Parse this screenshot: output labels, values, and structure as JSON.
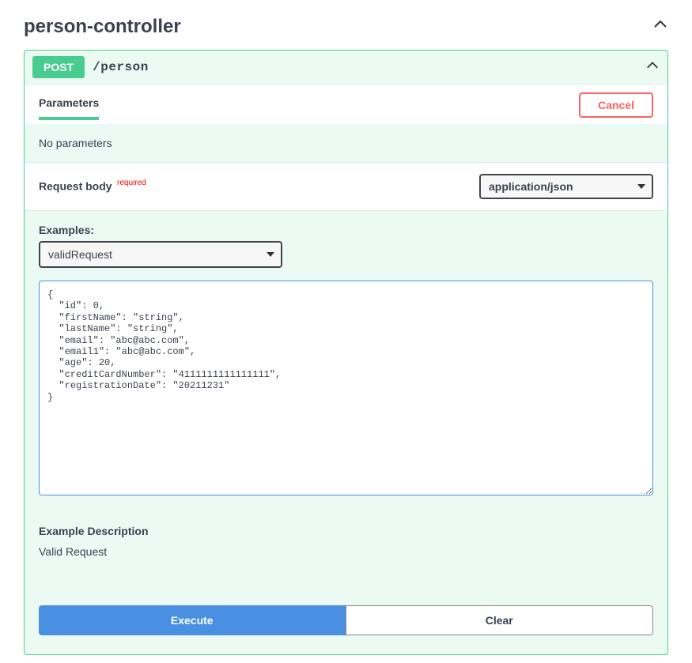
{
  "controller": {
    "title": "person-controller"
  },
  "operation": {
    "method": "POST",
    "path": "/person"
  },
  "parameters": {
    "tab_label": "Parameters",
    "cancel_label": "Cancel",
    "no_params_text": "No parameters"
  },
  "request_body": {
    "label": "Request body",
    "required_label": "required",
    "content_type": "application/json"
  },
  "examples": {
    "label": "Examples:",
    "selected": "validRequest"
  },
  "body_text": "{\n  \"id\": 0,\n  \"firstName\": \"string\",\n  \"lastName\": \"string\",\n  \"email\": \"abc@abc.com\",\n  \"email1\": \"abc@abc.com\",\n  \"age\": 20,\n  \"creditCardNumber\": \"4111111111111111\",\n  \"registrationDate\": \"20211231\"\n}",
  "example_description": {
    "label": "Example Description",
    "text": "Valid Request"
  },
  "actions": {
    "execute_label": "Execute",
    "clear_label": "Clear"
  }
}
